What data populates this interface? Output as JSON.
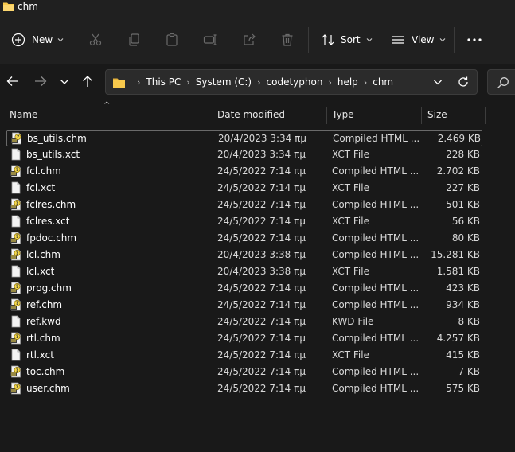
{
  "window": {
    "title": "chm"
  },
  "toolbar": {
    "new_label": "New",
    "sort_label": "Sort",
    "view_label": "View"
  },
  "address": {
    "crumbs": [
      "This PC",
      "System (C:)",
      "codetyphon",
      "help",
      "chm"
    ]
  },
  "columns": {
    "name": "Name",
    "date": "Date modified",
    "type": "Type",
    "size": "Size"
  },
  "files": [
    {
      "name": "bs_utils.chm",
      "date": "20/4/2023 3:34 πμ",
      "type": "Compiled HTML ...",
      "size": "2.469 KB",
      "icon": "chm-file-icon"
    },
    {
      "name": "bs_utils.xct",
      "date": "20/4/2023 3:34 πμ",
      "type": "XCT File",
      "size": "228 KB",
      "icon": "generic-file-icon"
    },
    {
      "name": "fcl.chm",
      "date": "24/5/2022 7:14 πμ",
      "type": "Compiled HTML ...",
      "size": "2.702 KB",
      "icon": "chm-file-icon"
    },
    {
      "name": "fcl.xct",
      "date": "24/5/2022 7:14 πμ",
      "type": "XCT File",
      "size": "227 KB",
      "icon": "generic-file-icon"
    },
    {
      "name": "fclres.chm",
      "date": "24/5/2022 7:14 πμ",
      "type": "Compiled HTML ...",
      "size": "501 KB",
      "icon": "chm-file-icon"
    },
    {
      "name": "fclres.xct",
      "date": "24/5/2022 7:14 πμ",
      "type": "XCT File",
      "size": "56 KB",
      "icon": "generic-file-icon"
    },
    {
      "name": "fpdoc.chm",
      "date": "24/5/2022 7:14 πμ",
      "type": "Compiled HTML ...",
      "size": "80 KB",
      "icon": "chm-file-icon"
    },
    {
      "name": "lcl.chm",
      "date": "20/4/2023 3:38 πμ",
      "type": "Compiled HTML ...",
      "size": "15.281 KB",
      "icon": "chm-file-icon"
    },
    {
      "name": "lcl.xct",
      "date": "20/4/2023 3:38 πμ",
      "type": "XCT File",
      "size": "1.581 KB",
      "icon": "generic-file-icon"
    },
    {
      "name": "prog.chm",
      "date": "24/5/2022 7:14 πμ",
      "type": "Compiled HTML ...",
      "size": "423 KB",
      "icon": "chm-file-icon"
    },
    {
      "name": "ref.chm",
      "date": "24/5/2022 7:14 πμ",
      "type": "Compiled HTML ...",
      "size": "934 KB",
      "icon": "chm-file-icon"
    },
    {
      "name": "ref.kwd",
      "date": "24/5/2022 7:14 πμ",
      "type": "KWD File",
      "size": "8 KB",
      "icon": "generic-file-icon"
    },
    {
      "name": "rtl.chm",
      "date": "24/5/2022 7:14 πμ",
      "type": "Compiled HTML ...",
      "size": "4.257 KB",
      "icon": "chm-file-icon"
    },
    {
      "name": "rtl.xct",
      "date": "24/5/2022 7:14 πμ",
      "type": "XCT File",
      "size": "415 KB",
      "icon": "generic-file-icon"
    },
    {
      "name": "toc.chm",
      "date": "24/5/2022 7:14 πμ",
      "type": "Compiled HTML ...",
      "size": "7 KB",
      "icon": "chm-file-icon"
    },
    {
      "name": "user.chm",
      "date": "24/5/2022 7:14 πμ",
      "type": "Compiled HTML ...",
      "size": "575 KB",
      "icon": "chm-file-icon"
    }
  ],
  "colors": {
    "background": "#191919",
    "toolbar": "#202020",
    "folder": "#f8c94c",
    "chm_help": "#f2d64b"
  }
}
